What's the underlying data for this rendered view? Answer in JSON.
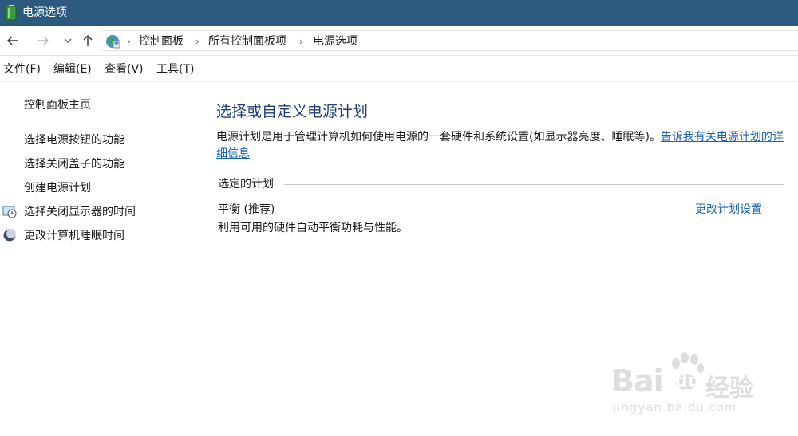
{
  "window": {
    "title": "电源选项"
  },
  "navigation": {
    "breadcrumb": [
      "控制面板",
      "所有控制面板项",
      "电源选项"
    ]
  },
  "menu": [
    "文件(F)",
    "编辑(E)",
    "查看(V)",
    "工具(T)"
  ],
  "sidebar": {
    "home": "控制面板主页",
    "links": [
      "选择电源按钮的功能",
      "选择关闭盖子的功能",
      "创建电源计划",
      "选择关闭显示器的时间",
      "更改计算机睡眠时间"
    ]
  },
  "main": {
    "heading": "选择或自定义电源计划",
    "description": "电源计划是用于管理计算机如何使用电源的一套硬件和系统设置(如显示器亮度、睡眠等)。",
    "description_link": "告诉我有关电源计划的详细信息",
    "section_label": "选定的计划",
    "plan": {
      "name": "平衡 (推荐)",
      "description": "利用可用的硬件自动平衡功耗与性能。",
      "change_link": "更改计划设置"
    }
  },
  "watermark": {
    "brand_a": "Bai",
    "brand_b": "du",
    "brand_cn": "经验",
    "url": "jingyan.baidu.com"
  },
  "colors": {
    "titlebar": "#2b5a7e",
    "heading": "#1e3e7a",
    "link": "#1a63b5"
  }
}
